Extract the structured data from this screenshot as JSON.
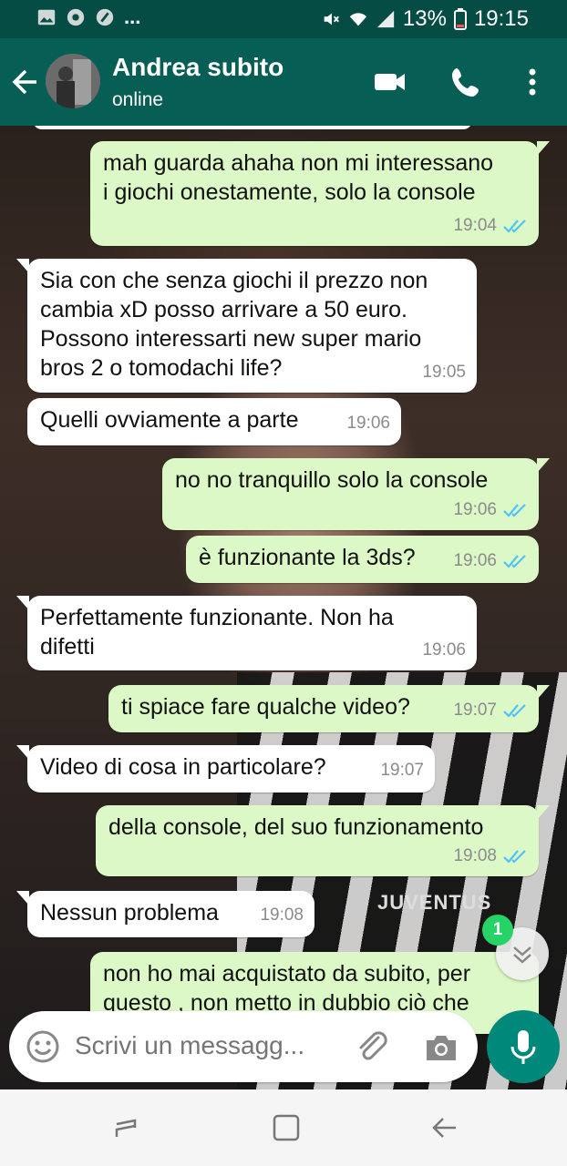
{
  "status_bar": {
    "left_icons": [
      "image-icon",
      "chrome-icon",
      "speed-icon"
    ],
    "more": "...",
    "right_icons": [
      "mute-icon",
      "wifi-icon",
      "signal-icon"
    ],
    "battery": "13%",
    "time": "19:15"
  },
  "header": {
    "contact_name": "Andrea subito",
    "status": "online",
    "actions": [
      "video-call-icon",
      "phone-icon",
      "more-vert-icon"
    ]
  },
  "messages": [
    {
      "dir": "out",
      "text": "mah guarda ahaha non mi interessano i giochi onestamente, solo la console",
      "time": "19:04",
      "read": true
    },
    {
      "dir": "in",
      "text": "Sia con che senza giochi il prezzo non cambia xD posso arrivare a 50 euro. Possono interessarti new super mario bros 2 o tomodachi life?",
      "time": "19:05"
    },
    {
      "dir": "in",
      "text": "Quelli ovviamente a parte",
      "time": "19:06"
    },
    {
      "dir": "out",
      "text": "no no tranquillo solo la console",
      "time": "19:06",
      "read": true
    },
    {
      "dir": "out",
      "text": "è funzionante la 3ds?",
      "time": "19:06",
      "read": true
    },
    {
      "dir": "in",
      "text": "Perfettamente funzionante. Non ha difetti",
      "time": "19:06"
    },
    {
      "dir": "out",
      "text": "ti spiace fare qualche video?",
      "time": "19:07",
      "read": true
    },
    {
      "dir": "in",
      "text": "Video di cosa in particolare?",
      "time": "19:07"
    },
    {
      "dir": "out",
      "text": "della console, del suo funzionamento",
      "time": "19:08",
      "read": true
    },
    {
      "dir": "in",
      "text": "Nessun problema",
      "time": "19:08"
    },
    {
      "dir": "out",
      "text": "non ho mai acquistato da subito, per questo , non metto in dubbio ciò che",
      "time": "",
      "read": false
    }
  ],
  "wallpaper_text": "JUVENTUS",
  "unread_badge": "1",
  "composer": {
    "placeholder": "Scrivi un messagg..."
  },
  "colors": {
    "header": "#075e54",
    "status_bar": "#054d44",
    "outgoing_bubble": "#dcf8c6",
    "incoming_bubble": "#ffffff",
    "read_ticks": "#4fc3f7",
    "mic_button": "#00897b"
  }
}
